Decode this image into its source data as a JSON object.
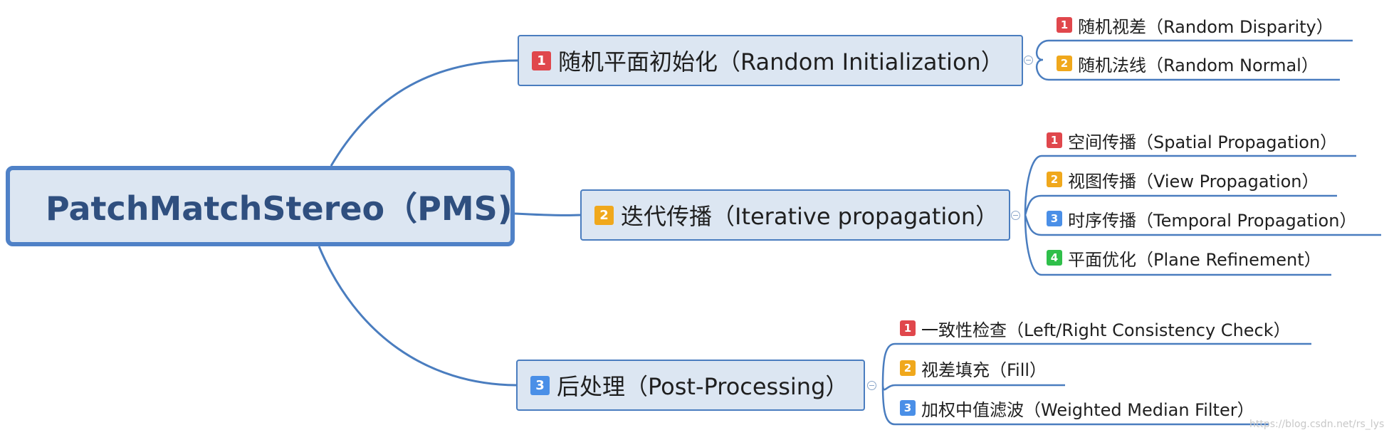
{
  "colors": {
    "line": "#4a7dbf",
    "node_fill": "#dce6f2",
    "badge_1": "#e0474c",
    "badge_2": "#f0a81c",
    "badge_3": "#4a8fe7",
    "badge_4": "#2fbf4a"
  },
  "root": {
    "title": "PatchMatchStereo（PMS)"
  },
  "branches": [
    {
      "badge": "1",
      "label": "随机平面初始化（Random Initialization）",
      "leaves": [
        {
          "badge": "1",
          "label": "随机视差（Random Disparity）"
        },
        {
          "badge": "2",
          "label": "随机法线（Random Normal）"
        }
      ]
    },
    {
      "badge": "2",
      "label": "迭代传播（Iterative propagation）",
      "leaves": [
        {
          "badge": "1",
          "label": "空间传播（Spatial Propagation）"
        },
        {
          "badge": "2",
          "label": "视图传播（View Propagation）"
        },
        {
          "badge": "3",
          "label": "时序传播（Temporal Propagation）"
        },
        {
          "badge": "4",
          "label": "平面优化（Plane Refinement）"
        }
      ]
    },
    {
      "badge": "3",
      "label": "后处理（Post-Processing）",
      "leaves": [
        {
          "badge": "1",
          "label": "一致性检查（Left/Right Consistency Check）"
        },
        {
          "badge": "2",
          "label": "视差填充（Fill）"
        },
        {
          "badge": "3",
          "label": "加权中值滤波（Weighted Median Filter）"
        }
      ]
    }
  ],
  "watermark": "https://blog.csdn.net/rs_lys"
}
